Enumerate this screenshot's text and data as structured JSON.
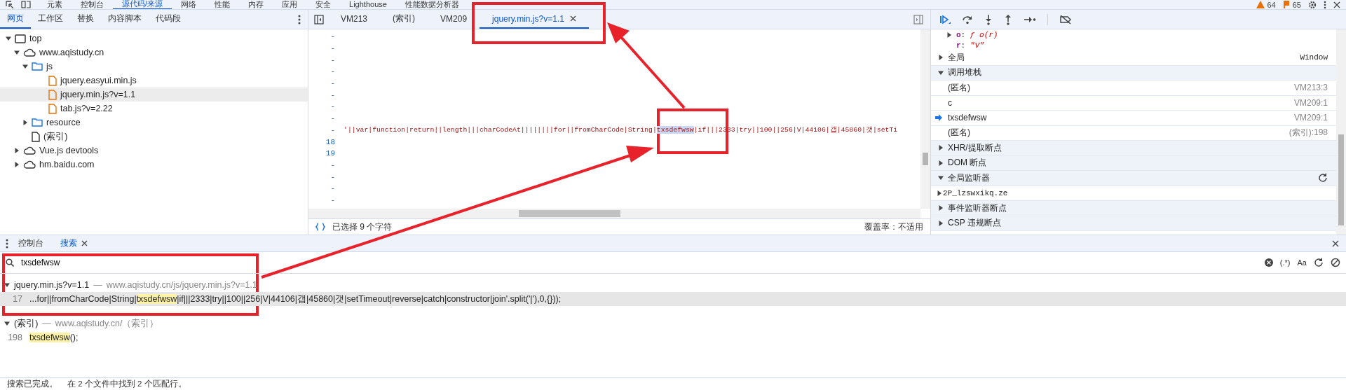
{
  "top_tabs": [
    {
      "label": "元素",
      "selected": false
    },
    {
      "label": "控制台",
      "selected": false
    },
    {
      "label": "源代码/来源",
      "selected": true
    },
    {
      "label": "网络",
      "selected": false
    },
    {
      "label": "性能",
      "selected": false
    },
    {
      "label": "内存",
      "selected": false
    },
    {
      "label": "应用",
      "selected": false
    },
    {
      "label": "安全",
      "selected": false
    },
    {
      "label": "Lighthouse",
      "selected": false
    },
    {
      "label": "性能数据分析器",
      "selected": false
    }
  ],
  "top_right": {
    "warnings": "64",
    "issues": "65"
  },
  "navigator": {
    "tabs": [
      {
        "label": "网页",
        "selected": true
      },
      {
        "label": "工作区",
        "selected": false
      },
      {
        "label": "替换",
        "selected": false
      },
      {
        "label": "内容脚本",
        "selected": false
      },
      {
        "label": "代码段",
        "selected": false
      }
    ],
    "tree": [
      {
        "label": "top",
        "kind": "frame",
        "expanded": true,
        "selected": false,
        "children": [
          {
            "label": "www.aqistudy.cn",
            "kind": "domain",
            "expanded": true,
            "selected": false,
            "children": [
              {
                "label": "js",
                "kind": "folder",
                "expanded": true,
                "selected": false,
                "children": [
                  {
                    "label": "jquery.easyui.min.js",
                    "kind": "script",
                    "selected": false
                  },
                  {
                    "label": "jquery.min.js?v=1.1",
                    "kind": "script",
                    "selected": true
                  },
                  {
                    "label": "tab.js?v=2.22",
                    "kind": "script",
                    "selected": false
                  }
                ]
              },
              {
                "label": "resource",
                "kind": "folder",
                "expanded": false,
                "selected": false
              },
              {
                "label": "(索引)",
                "kind": "document",
                "selected": false
              }
            ]
          },
          {
            "label": "Vue.js devtools",
            "kind": "domain",
            "expanded": false,
            "selected": false
          },
          {
            "label": "hm.baidu.com",
            "kind": "domain",
            "expanded": false,
            "selected": false
          }
        ]
      }
    ]
  },
  "editor": {
    "tabs": [
      {
        "label": "VM213",
        "selected": false
      },
      {
        "label": "(索引)",
        "selected": false
      },
      {
        "label": "VM209",
        "selected": false
      },
      {
        "label": "jquery.min.js?v=1.1",
        "selected": true
      }
    ],
    "lines": [
      {
        "gutter": "-"
      },
      {
        "gutter": "-"
      },
      {
        "gutter": "-"
      },
      {
        "gutter": "-"
      },
      {
        "gutter": "-"
      },
      {
        "gutter": "-"
      },
      {
        "gutter": "-"
      },
      {
        "gutter": "-"
      },
      {
        "gutter": "-",
        "before": "'||var|function|return||length|||charCodeAt||||||||for||fromCharCode|String|",
        "selection": "txsdefwsw",
        "after": "|if|||2333|try||100||256|V|44106|갭|45860|갯|setTi"
      },
      {
        "gutter": "18"
      },
      {
        "gutter": "19"
      },
      {
        "gutter": "-"
      },
      {
        "gutter": "-"
      },
      {
        "gutter": "-"
      },
      {
        "gutter": "-"
      }
    ],
    "status": "已选择 9 个字符",
    "coverage": "覆盖率：不适用"
  },
  "debugger": {
    "scope": [
      {
        "name": "o",
        "separator": ":",
        "value": "ƒ o(r)",
        "expandable": true
      },
      {
        "name": "r",
        "separator": ":",
        "value": "\"V\"",
        "expandable": false
      }
    ],
    "global": {
      "label": "全局",
      "value": "Window"
    },
    "call_stack": {
      "label": "调用堆栈",
      "expanded": true,
      "frames": [
        {
          "name": "(匿名)",
          "location": "VM213:3",
          "current": false
        },
        {
          "name": "c",
          "location": "VM209:1",
          "current": false
        },
        {
          "name": "txsdefwsw",
          "location": "VM209:1",
          "current": true
        },
        {
          "name": "(匿名)",
          "location": "(索引):198",
          "current": false
        }
      ]
    },
    "sections": [
      {
        "label": "XHR/提取断点",
        "expanded": false
      },
      {
        "label": "DOM 断点",
        "expanded": false
      },
      {
        "label": "全局监听器",
        "expanded": true,
        "refresh": true,
        "items": [
          "2P_lzswxikq.ze"
        ]
      },
      {
        "label": "事件监听器断点",
        "expanded": false
      },
      {
        "label": "CSP 违规断点",
        "expanded": false
      }
    ]
  },
  "drawer": {
    "tabs": [
      {
        "label": "控制台",
        "selected": false,
        "closable": false
      },
      {
        "label": "搜索",
        "selected": true,
        "closable": true
      }
    ],
    "search": {
      "value": "txsdefwsw",
      "regex": "(.*)",
      "case": "Aa"
    },
    "results": [
      {
        "file": "jquery.min.js?v=1.1",
        "dash": "—",
        "url": "www.aqistudy.cn/js/jquery.min.js?v=1.1",
        "matches": [
          {
            "line": "17",
            "before": "...for||fromCharCode|String|",
            "match": "txsdefwsw",
            "after": "|if|||2333|try||100||256|V|44106|갭|45860|갯|setTimeout|reverse|catch|constructor|join'.split('|'),0,{}));",
            "selected": true
          }
        ]
      },
      {
        "file": "(索引)",
        "dash": "—",
        "url": "www.aqistudy.cn/（索引）",
        "matches": [
          {
            "line": "198",
            "match": "txsdefwsw",
            "after": "();",
            "selected": false
          }
        ]
      }
    ],
    "status": "搜索已完成。",
    "summary": "在 2 个文件中找到 2 个匹配行。"
  }
}
